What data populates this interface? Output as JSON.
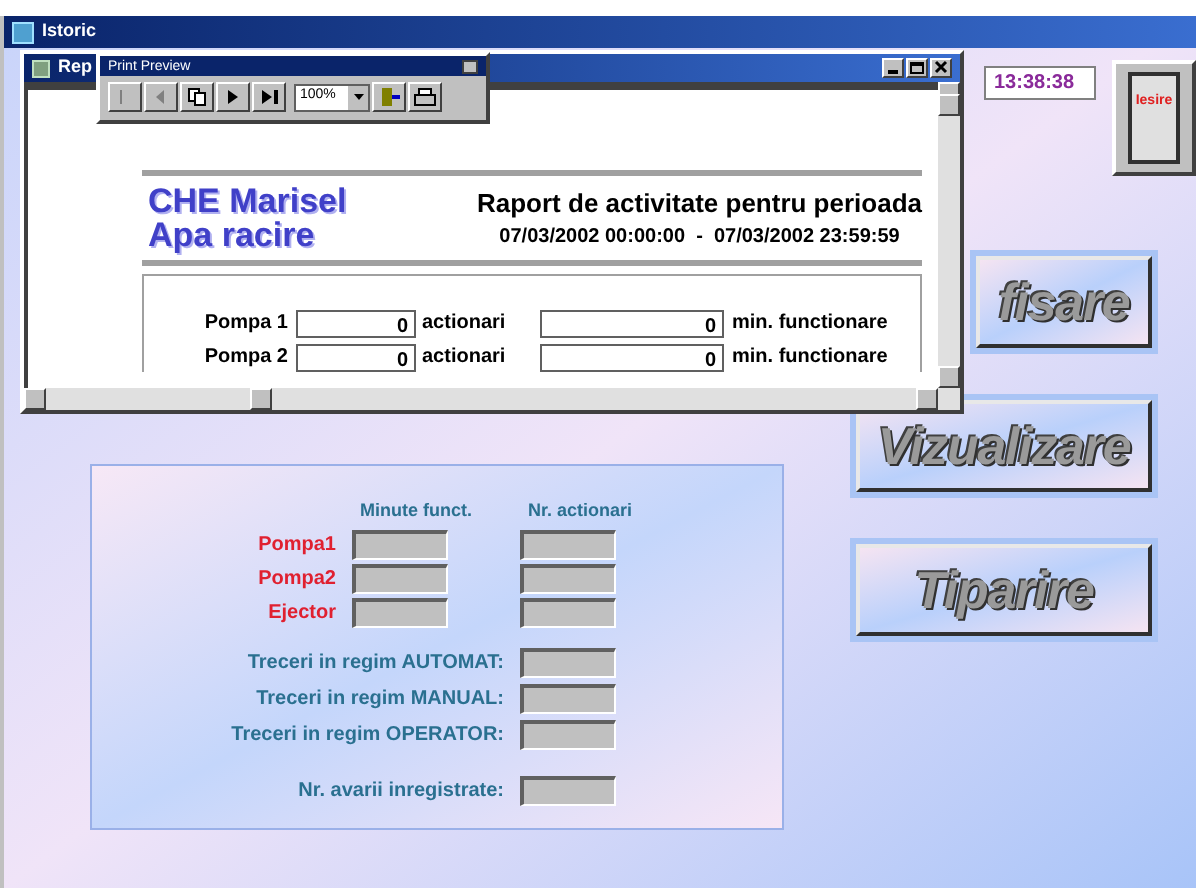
{
  "window": {
    "title": "Istoric"
  },
  "clock": "13:38:38",
  "exit_button": {
    "label": "Iesire"
  },
  "report_window": {
    "title": "Rep",
    "toolbar": {
      "title": "Print Preview",
      "zoom": "100%"
    },
    "report": {
      "company": "CHE Marisel",
      "subtitle": "Apa racire",
      "heading": "Raport de activitate pentru perioada",
      "period": "07/03/2002 00:00:00  -  07/03/2002 23:59:59",
      "rows": [
        {
          "label": "Pompa 1",
          "actuations": "0",
          "actuations_unit": "actionari",
          "minutes": "0",
          "minutes_unit": "min. functionare"
        },
        {
          "label": "Pompa 2",
          "actuations": "0",
          "actuations_unit": "actionari",
          "minutes": "0",
          "minutes_unit": "min. functionare"
        }
      ]
    }
  },
  "form": {
    "columns": [
      "Minute funct.",
      "Nr. actionari"
    ],
    "equipment": [
      "Pompa1",
      "Pompa2",
      "Ejector"
    ],
    "modes": [
      "Treceri in regim AUTOMAT:",
      "Treceri in regim MANUAL:",
      "Treceri in regim OPERATOR:"
    ],
    "faults": "Nr. avarii inregistrate:"
  },
  "buttons": [
    "fisare",
    "Vizualizare",
    "Tiparire"
  ]
}
